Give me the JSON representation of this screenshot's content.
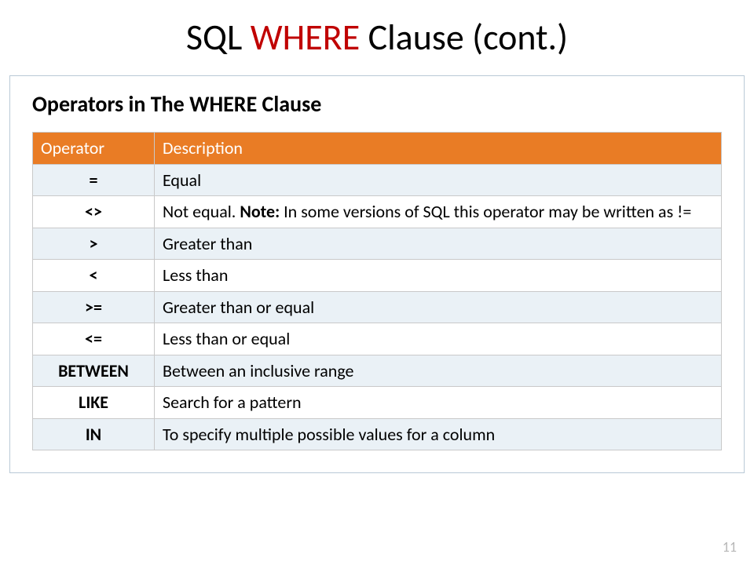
{
  "title": {
    "part1": "SQL ",
    "highlight": "WHERE",
    "part2": " Clause (cont.)"
  },
  "subheading": "Operators in The WHERE Clause",
  "table": {
    "headers": {
      "col1": "Operator",
      "col2": "Description"
    },
    "rows": [
      {
        "op": "=",
        "desc": "Equal"
      },
      {
        "op": "<>",
        "desc_pre": "Not equal. ",
        "note_label": "Note:",
        "desc_post": " In some versions of SQL this operator may be written as !="
      },
      {
        "op": ">",
        "desc": "Greater than"
      },
      {
        "op": "<",
        "desc": "Less than"
      },
      {
        "op": ">=",
        "desc": "Greater than or equal"
      },
      {
        "op": "<=",
        "desc": "Less than or equal"
      },
      {
        "op": "BETWEEN",
        "desc": "Between an inclusive range"
      },
      {
        "op": "LIKE",
        "desc": "Search for a pattern"
      },
      {
        "op": "IN",
        "desc": "To specify multiple possible values for a column"
      }
    ]
  },
  "page_number": "11"
}
